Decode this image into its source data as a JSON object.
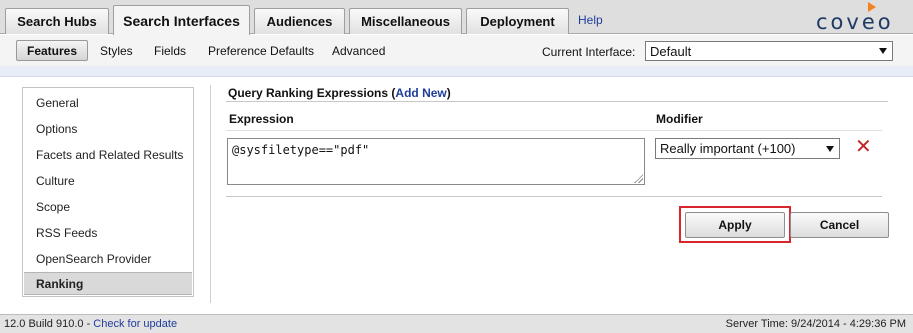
{
  "tabs": [
    "Search Hubs",
    "Search Interfaces",
    "Audiences",
    "Miscellaneous",
    "Deployment"
  ],
  "active_tab": "Search Interfaces",
  "help_label": "Help",
  "logo_text": "coveo",
  "subtabs": [
    "Features",
    "Styles",
    "Fields",
    "Preference Defaults",
    "Advanced"
  ],
  "active_subtab": "Features",
  "current_interface": {
    "label": "Current Interface:",
    "value": "Default"
  },
  "nav": {
    "items": [
      "General",
      "Options",
      "Facets and Related Results",
      "Culture",
      "Scope",
      "RSS Feeds",
      "OpenSearch Provider",
      "Ranking"
    ],
    "active": "Ranking"
  },
  "section": {
    "title": "Query Ranking Expressions",
    "open_paren": "(",
    "add_new": "Add New",
    "close_paren": ")"
  },
  "columns": {
    "expression": "Expression",
    "modifier": "Modifier"
  },
  "row": {
    "expression": "@sysfiletype==\"pdf\"",
    "modifier": "Really important (+100)",
    "delete_icon": "close-icon-red"
  },
  "buttons": {
    "apply": "Apply",
    "cancel": "Cancel"
  },
  "status": {
    "version": "12.0 Build 910.0",
    "separator": " - ",
    "update_link": "Check for update",
    "server_time": "Server Time: 9/24/2014 - 4:29:36 PM"
  },
  "colors": {
    "highlight": "#d8262e",
    "link": "#1f3c9b",
    "delete": "#c0262b",
    "logo_accent": "#f58220"
  }
}
